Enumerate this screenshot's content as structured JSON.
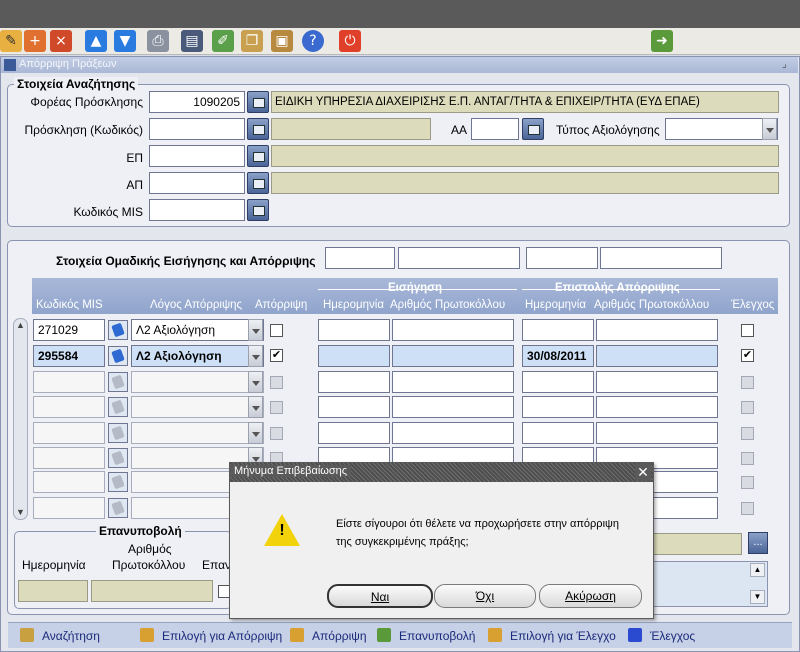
{
  "toolbar": {
    "icons": [
      "new-record-icon",
      "insert-record-icon",
      "delete-record-icon",
      "arrow-up-icon",
      "arrow-down-icon",
      "print-icon",
      "save-icon",
      "edit-icon",
      "copy-icon",
      "paste-icon",
      "help-icon",
      "exit-icon",
      "navigator-icon"
    ]
  },
  "window": {
    "title": "Απόρριψη Πράξεων"
  },
  "search": {
    "legend": "Στοιχεία Αναζήτησης",
    "foreas_label": "Φορέας Πρόσκλησης",
    "foreas_code": "1090205",
    "foreas_name": "ΕΙΔΙΚΗ ΥΠΗΡΕΣΙΑ ΔΙΑΧΕΙΡΙΣΗΣ Ε.Π. ΑΝΤΑΓ/ΤΗΤΑ & ΕΠΙΧΕΙΡ/ΤΗΤΑ (ΕΥΔ ΕΠΑΕ)",
    "prosklisi_label": "Πρόσκληση (Κωδικός)",
    "aa_label": "ΑΑ",
    "typos_label": "Τύπος Αξιολόγησης",
    "ep_label": "ΕΠ",
    "ap_label": "ΑΠ",
    "mis_label": "Κωδικός MIS"
  },
  "grid": {
    "group_title": "Στοιχεία Ομαδικής Εισήγησης και Απόρριψης",
    "headers": {
      "mis": "Κωδικός MIS",
      "reason": "Λόγος Απόρριψης",
      "reject": "Απόρριψη",
      "eisigisi": "Εισήγηση",
      "epistoli": "Επιστολής Απόρριψης",
      "date": "Ημερομηνία",
      "protocol": "Αριθμός Πρωτοκόλλου",
      "check": "Έλεγχος"
    },
    "rows": [
      {
        "mis": "271029",
        "reason": "Λ2 Αξιολόγηση",
        "reject": "",
        "eis_date": "",
        "eis_prot": "",
        "epi_date": "",
        "epi_prot": "",
        "check": ""
      },
      {
        "mis": "295584",
        "reason": "Λ2 Αξιολόγηση",
        "reject": "✔",
        "eis_date": "",
        "eis_prot": "",
        "epi_date": "30/08/2011",
        "epi_prot": "",
        "check": "✔"
      }
    ]
  },
  "resubmit": {
    "legend": "Επανυποβολή",
    "date": "Ημερομηνία",
    "protocol_1": "Αριθμός",
    "protocol_2": "Πρωτοκόλλου",
    "epan": "Επαν"
  },
  "dialog": {
    "title": "Μήνυμα Επιβεβαίωσης",
    "message_1": "Είστε σίγουροι ότι θέλετε να προχωρήσετε στην απόρριψη",
    "message_2": "της συγκεκριμένης πράξης;",
    "yes": "Ναι",
    "no": "Όχι",
    "cancel": "Ακύρωση"
  },
  "bottom": {
    "search": "Αναζήτηση",
    "select_reject": "Επιλογή για Απόρριψη",
    "reject": "Απόρριψη",
    "resubmit": "Επανυποβολή",
    "select_check": "Επιλογή για Έλεγχο",
    "check": "Έλεγχος"
  },
  "colors": {
    "accent": "#90a4cc",
    "readonly": "#dcdcbc",
    "selected_row": "#cde0f6",
    "close_button": "#e0402a"
  }
}
